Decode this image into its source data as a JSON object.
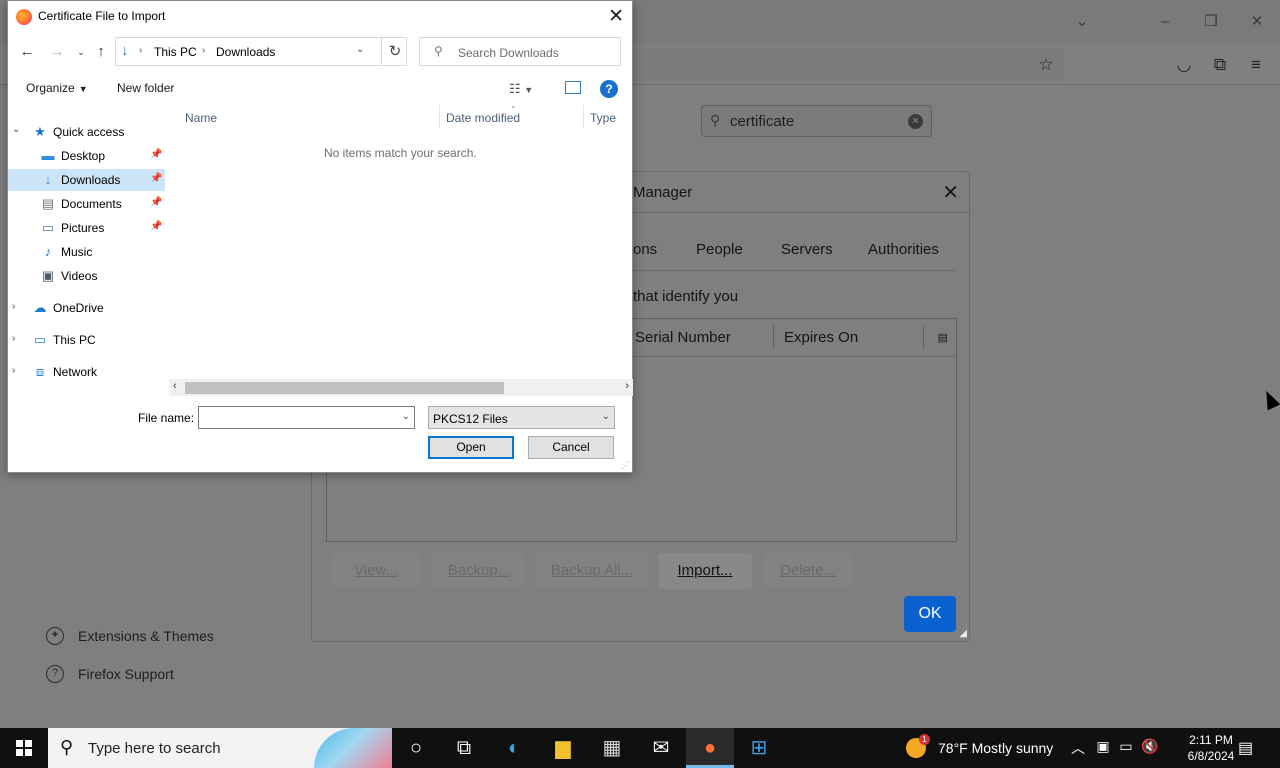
{
  "colors": {
    "primary_button": "#0a62d0",
    "selected_tree": "#cce4f7",
    "taskbar": "#101010",
    "dim_overlay": "#7f7f7f"
  },
  "firefox": {
    "search_query": "certificate",
    "sidebar": [
      {
        "label": "Extensions & Themes",
        "icon": "puzzle-icon"
      },
      {
        "label": "Firefox Support",
        "icon": "help-icon"
      }
    ]
  },
  "cert_manager": {
    "title": "Manager",
    "tabs": [
      "ons",
      "People",
      "Servers",
      "Authorities"
    ],
    "description": "that identify you",
    "columns": [
      "Serial Number",
      "Expires On"
    ],
    "buttons": [
      "View...",
      "Backup...",
      "Backup All...",
      "Import...",
      "Delete..."
    ],
    "ok_label": "OK"
  },
  "file_dialog": {
    "title": "Certificate File to Import",
    "breadcrumb": [
      "This PC",
      "Downloads"
    ],
    "search_placeholder": "Search Downloads",
    "toolbar": {
      "organize": "Organize",
      "new_folder": "New folder"
    },
    "tree": [
      {
        "label": "Quick access",
        "icon": "star-icon",
        "level": 0,
        "expanded": true
      },
      {
        "label": "Desktop",
        "icon": "desktop-icon",
        "level": 1,
        "pinned": true
      },
      {
        "label": "Downloads",
        "icon": "download-icon",
        "level": 1,
        "pinned": true,
        "selected": true
      },
      {
        "label": "Documents",
        "icon": "document-icon",
        "level": 1,
        "pinned": true
      },
      {
        "label": "Pictures",
        "icon": "picture-icon",
        "level": 1,
        "pinned": true
      },
      {
        "label": "Music",
        "icon": "music-icon",
        "level": 1
      },
      {
        "label": "Videos",
        "icon": "video-icon",
        "level": 1
      },
      {
        "label": "OneDrive",
        "icon": "cloud-icon",
        "level": 0
      },
      {
        "label": "This PC",
        "icon": "computer-icon",
        "level": 0
      },
      {
        "label": "Network",
        "icon": "network-icon",
        "level": 0
      }
    ],
    "columns": [
      "Name",
      "Date modified",
      "Type"
    ],
    "empty_message": "No items match your search.",
    "file_name_label": "File name:",
    "file_name_value": "",
    "file_type": "PKCS12 Files",
    "open_label": "Open",
    "cancel_label": "Cancel"
  },
  "taskbar": {
    "search_placeholder": "Type here to search",
    "weather": "78°F  Mostly sunny",
    "weather_badge": "1",
    "time": "2:11 PM",
    "date": "6/8/2024"
  }
}
